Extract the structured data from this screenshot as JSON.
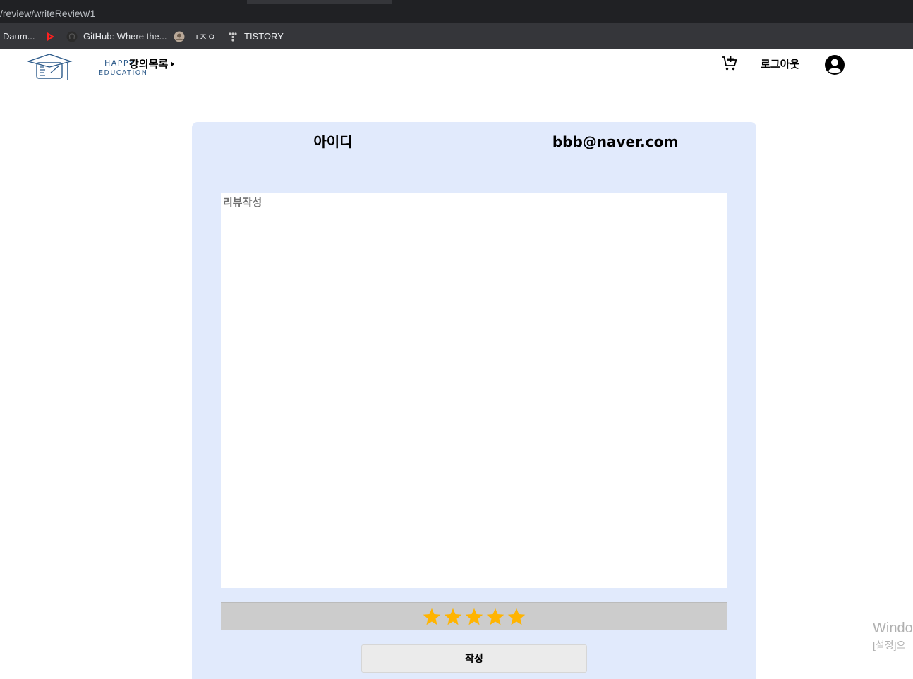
{
  "browser": {
    "url": "/review/writeReview/1",
    "bookmarks": [
      {
        "label": "Daum...",
        "icon": "daum-icon"
      },
      {
        "label": "",
        "icon": "youtube-play-icon"
      },
      {
        "label": "GitHub: Where the...",
        "icon": "github-icon"
      },
      {
        "label": "ㄱㅈㅇ",
        "icon": "profile-avatar-icon"
      },
      {
        "label": "TISTORY",
        "icon": "tistory-icon"
      }
    ]
  },
  "header": {
    "logo_line1": "HAPPY",
    "logo_line2": "EDUCATION",
    "nav_courses": "강의목록",
    "logout": "로그아웃",
    "cart_icon": "cart-add-icon",
    "user_icon": "account-circle-icon"
  },
  "review": {
    "id_label": "아이디",
    "id_value": "bbb@naver.com",
    "textarea_placeholder": "리뷰작성",
    "textarea_value": "",
    "rating": 5,
    "max_rating": 5,
    "star_color": "#ffb400",
    "submit_label": "작성"
  },
  "watermark": {
    "line1": "Windo",
    "line2": "[설정]으"
  },
  "colors": {
    "card_bg": "#e1eafc",
    "rating_bar_bg": "#cccccc",
    "brand": "#2c5a8a"
  }
}
